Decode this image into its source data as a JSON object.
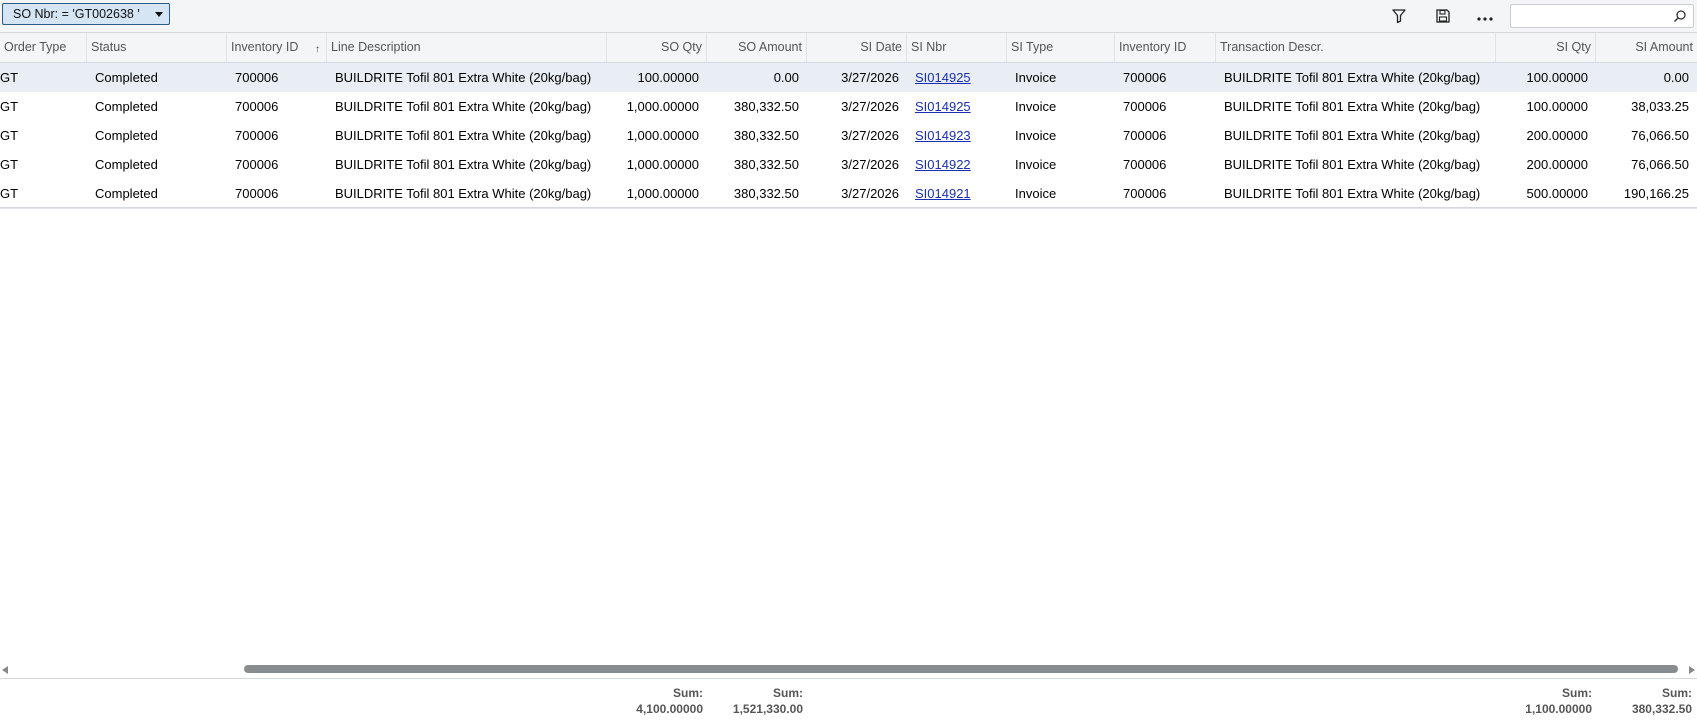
{
  "toolbar": {
    "filter_chip": "SO Nbr: = 'GT002638 '",
    "search_placeholder": ""
  },
  "columns": [
    "Order Type",
    "Status",
    "Inventory ID",
    "Line Description",
    "SO Qty",
    "SO Amount",
    "SI Date",
    "SI Nbr",
    "SI Type",
    "Inventory ID",
    "Transaction Descr.",
    "SI Qty",
    "SI Amount"
  ],
  "rows": [
    [
      "GT",
      "Completed",
      "700006",
      "BUILDRITE Tofil 801 Extra White (20kg/bag)",
      "100.00000",
      "0.00",
      "3/27/2026",
      "SI014925",
      "Invoice",
      "700006",
      "BUILDRITE Tofil 801 Extra White (20kg/bag)",
      "100.00000",
      "0.00"
    ],
    [
      "GT",
      "Completed",
      "700006",
      "BUILDRITE Tofil 801 Extra White (20kg/bag)",
      "1,000.00000",
      "380,332.50",
      "3/27/2026",
      "SI014925",
      "Invoice",
      "700006",
      "BUILDRITE Tofil 801 Extra White (20kg/bag)",
      "100.00000",
      "38,033.25"
    ],
    [
      "GT",
      "Completed",
      "700006",
      "BUILDRITE Tofil 801 Extra White (20kg/bag)",
      "1,000.00000",
      "380,332.50",
      "3/27/2026",
      "SI014923",
      "Invoice",
      "700006",
      "BUILDRITE Tofil 801 Extra White (20kg/bag)",
      "200.00000",
      "76,066.50"
    ],
    [
      "GT",
      "Completed",
      "700006",
      "BUILDRITE Tofil 801 Extra White (20kg/bag)",
      "1,000.00000",
      "380,332.50",
      "3/27/2026",
      "SI014922",
      "Invoice",
      "700006",
      "BUILDRITE Tofil 801 Extra White (20kg/bag)",
      "200.00000",
      "76,066.50"
    ],
    [
      "GT",
      "Completed",
      "700006",
      "BUILDRITE Tofil 801 Extra White (20kg/bag)",
      "1,000.00000",
      "380,332.50",
      "3/27/2026",
      "SI014921",
      "Invoice",
      "700006",
      "BUILDRITE Tofil 801 Extra White (20kg/bag)",
      "500.00000",
      "190,166.25"
    ]
  ],
  "footer": {
    "sum_label": "Sum:",
    "so_qty_sum": "4,100.00000",
    "so_amount_sum": "1,521,330.00",
    "si_qty_sum": "1,100.00000",
    "si_amount_sum": "380,332.50"
  },
  "icons": {
    "filter": "filter-icon",
    "save": "save-icon",
    "more": "more-icon",
    "search": "search-icon",
    "sort": "sort-ascending-icon"
  }
}
